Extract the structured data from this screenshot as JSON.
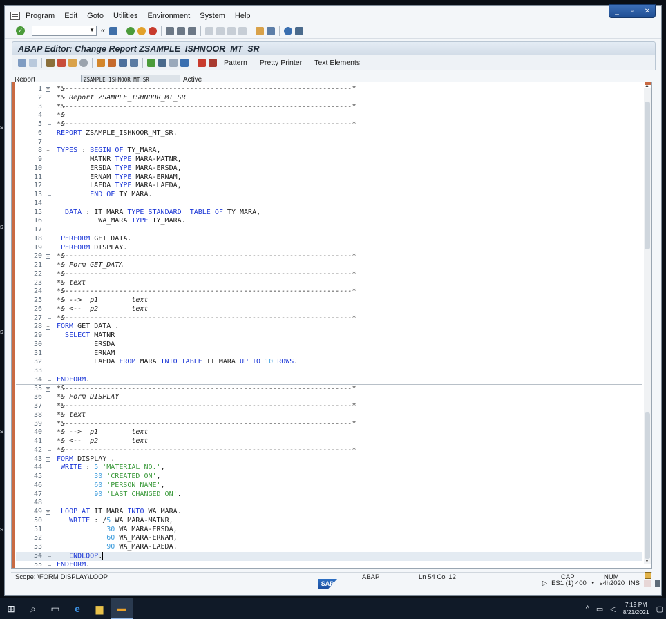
{
  "window": {
    "controls": [
      "_",
      "▫",
      "✕"
    ]
  },
  "menu": [
    "Program",
    "Edit",
    "Goto",
    "Utilities",
    "Environment",
    "System",
    "Help"
  ],
  "command_field": {
    "value": ""
  },
  "title": "ABAP Editor: Change Report ZSAMPLE_ISHNOOR_MT_SR",
  "app_toolbar": {
    "pattern": "Pattern",
    "pretty_printer": "Pretty Printer",
    "text_elements": "Text Elements"
  },
  "report": {
    "label": "Report",
    "value": "ZSAMPLE_ISHNOOR_MT_SR",
    "status": "Active"
  },
  "code_lines": [
    {
      "n": "1",
      "t": "*&---------------------------------------------------------------------*",
      "c": "cm"
    },
    {
      "n": "2",
      "t": "*& Report ZSAMPLE_ISHNOOR_MT_SR",
      "c": "cm"
    },
    {
      "n": "3",
      "t": "*&---------------------------------------------------------------------*",
      "c": "cm"
    },
    {
      "n": "4",
      "t": "*&",
      "c": "cm"
    },
    {
      "n": "5",
      "t": "*&---------------------------------------------------------------------*",
      "c": "cm"
    },
    {
      "n": "6",
      "t": "REPORT ZSAMPLE_ISHNOOR_MT_SR."
    },
    {
      "n": "7",
      "t": ""
    },
    {
      "n": "8",
      "t": "TYPES : BEGIN OF TY_MARA,"
    },
    {
      "n": "9",
      "t": "        MATNR TYPE MARA-MATNR,"
    },
    {
      "n": "10",
      "t": "        ERSDA TYPE MARA-ERSDA,"
    },
    {
      "n": "11",
      "t": "        ERNAM TYPE MARA-ERNAM,"
    },
    {
      "n": "12",
      "t": "        LAEDA TYPE MARA-LAEDA,"
    },
    {
      "n": "13",
      "t": "        END OF TY_MARA."
    },
    {
      "n": "14",
      "t": ""
    },
    {
      "n": "15",
      "t": "  DATA : IT_MARA TYPE STANDARD  TABLE OF TY_MARA,"
    },
    {
      "n": "16",
      "t": "          WA_MARA TYPE TY_MARA."
    },
    {
      "n": "17",
      "t": ""
    },
    {
      "n": "18",
      "t": " PERFORM GET_DATA."
    },
    {
      "n": "19",
      "t": " PERFORM DISPLAY."
    },
    {
      "n": "20",
      "t": "*&---------------------------------------------------------------------*",
      "c": "cm"
    },
    {
      "n": "21",
      "t": "*& Form GET_DATA",
      "c": "cm"
    },
    {
      "n": "22",
      "t": "*&---------------------------------------------------------------------*",
      "c": "cm"
    },
    {
      "n": "23",
      "t": "*& text",
      "c": "cm"
    },
    {
      "n": "24",
      "t": "*&---------------------------------------------------------------------*",
      "c": "cm"
    },
    {
      "n": "25",
      "t": "*& -->  p1        text",
      "c": "cm"
    },
    {
      "n": "26",
      "t": "*& <--  p2        text",
      "c": "cm"
    },
    {
      "n": "27",
      "t": "*&---------------------------------------------------------------------*",
      "c": "cm"
    },
    {
      "n": "28",
      "t": "FORM GET_DATA ."
    },
    {
      "n": "29",
      "t": "  SELECT MATNR"
    },
    {
      "n": "30",
      "t": "         ERSDA"
    },
    {
      "n": "31",
      "t": "         ERNAM"
    },
    {
      "n": "32",
      "t": "         LAEDA FROM MARA INTO TABLE IT_MARA UP TO 10 ROWS."
    },
    {
      "n": "33",
      "t": ""
    },
    {
      "n": "34",
      "t": "ENDFORM."
    },
    {
      "n": "35",
      "t": "*&---------------------------------------------------------------------*",
      "c": "cm"
    },
    {
      "n": "36",
      "t": "*& Form DISPLAY",
      "c": "cm"
    },
    {
      "n": "37",
      "t": "*&---------------------------------------------------------------------*",
      "c": "cm"
    },
    {
      "n": "38",
      "t": "*& text",
      "c": "cm"
    },
    {
      "n": "39",
      "t": "*&---------------------------------------------------------------------*",
      "c": "cm"
    },
    {
      "n": "40",
      "t": "*& -->  p1        text",
      "c": "cm"
    },
    {
      "n": "41",
      "t": "*& <--  p2        text",
      "c": "cm"
    },
    {
      "n": "42",
      "t": "*&---------------------------------------------------------------------*",
      "c": "cm"
    },
    {
      "n": "43",
      "t": "FORM DISPLAY ."
    },
    {
      "n": "44",
      "t": " WRITE : 5 'MATERIAL NO.',"
    },
    {
      "n": "45",
      "t": "         30 'CREATED ON',"
    },
    {
      "n": "46",
      "t": "         60 'PERSON NAME',"
    },
    {
      "n": "47",
      "t": "         90 'LAST CHANGED ON'."
    },
    {
      "n": "48",
      "t": ""
    },
    {
      "n": "49",
      "t": " LOOP AT IT_MARA INTO WA_MARA."
    },
    {
      "n": "50",
      "t": "   WRITE : /5 WA_MARA-MATNR,"
    },
    {
      "n": "51",
      "t": "            30 WA_MARA-ERSDA,"
    },
    {
      "n": "52",
      "t": "            60 WA_MARA-ERNAM,"
    },
    {
      "n": "53",
      "t": "            90 WA_MARA-LAEDA."
    },
    {
      "n": "54",
      "t": "   ENDLOOP."
    },
    {
      "n": "55",
      "t": "ENDFORM."
    }
  ],
  "status": {
    "scope": "Scope: \\FORM DISPLAY\\LOOP",
    "lang": "ABAP",
    "pos": "Ln  54 Col  12",
    "caps": "CAP",
    "num": "NUM"
  },
  "system": {
    "session": "ES1 (1) 400",
    "server": "s4h2020",
    "mode": "INS"
  },
  "sap_logo": "SAP",
  "clock": {
    "time": "7:19 PM",
    "date": "8/21/2021"
  }
}
